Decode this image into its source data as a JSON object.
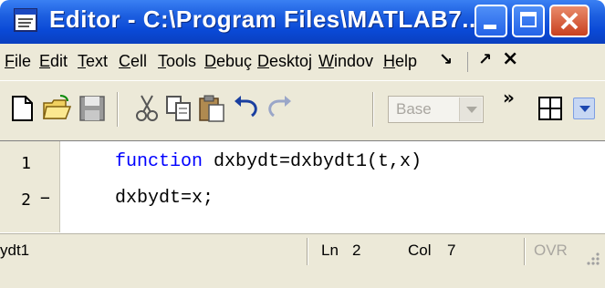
{
  "window": {
    "title": "Editor - C:\\Program Files\\MATLAB7...",
    "title_icon": "editor-document-icon"
  },
  "menu": {
    "items": [
      "File",
      "Edit",
      "Text",
      "Cell",
      "Tools",
      "Debuç",
      "Desktoj",
      "Windov",
      "Help"
    ],
    "dock_glyph": "↘",
    "undock_glyph": "↗",
    "close_glyph": "×"
  },
  "toolbar": {
    "icons": [
      "new-file-icon",
      "open-folder-icon",
      "save-icon",
      "cut-icon",
      "copy-icon",
      "paste-icon",
      "undo-icon",
      "redo-icon"
    ],
    "stack_select": {
      "value": "Base"
    },
    "overflow_glyph": "»",
    "layout_icon": "tile-grid-icon"
  },
  "editor": {
    "lines": [
      {
        "number": "1",
        "marker": "",
        "keyword": "function",
        "text": " dxbydt=dxbydt1(t,x)"
      },
      {
        "number": "2",
        "marker": "−",
        "keyword": "",
        "text": "dxbydt=x;"
      }
    ]
  },
  "status": {
    "file": "ydt1",
    "ln_label": "Ln",
    "ln_value": "2",
    "col_label": "Col",
    "col_value": "7",
    "ovr": "OVR"
  },
  "colors": {
    "title_blue": "#0a49d6",
    "chrome_beige": "#ece9d8",
    "keyword_blue": "#0000ff"
  }
}
